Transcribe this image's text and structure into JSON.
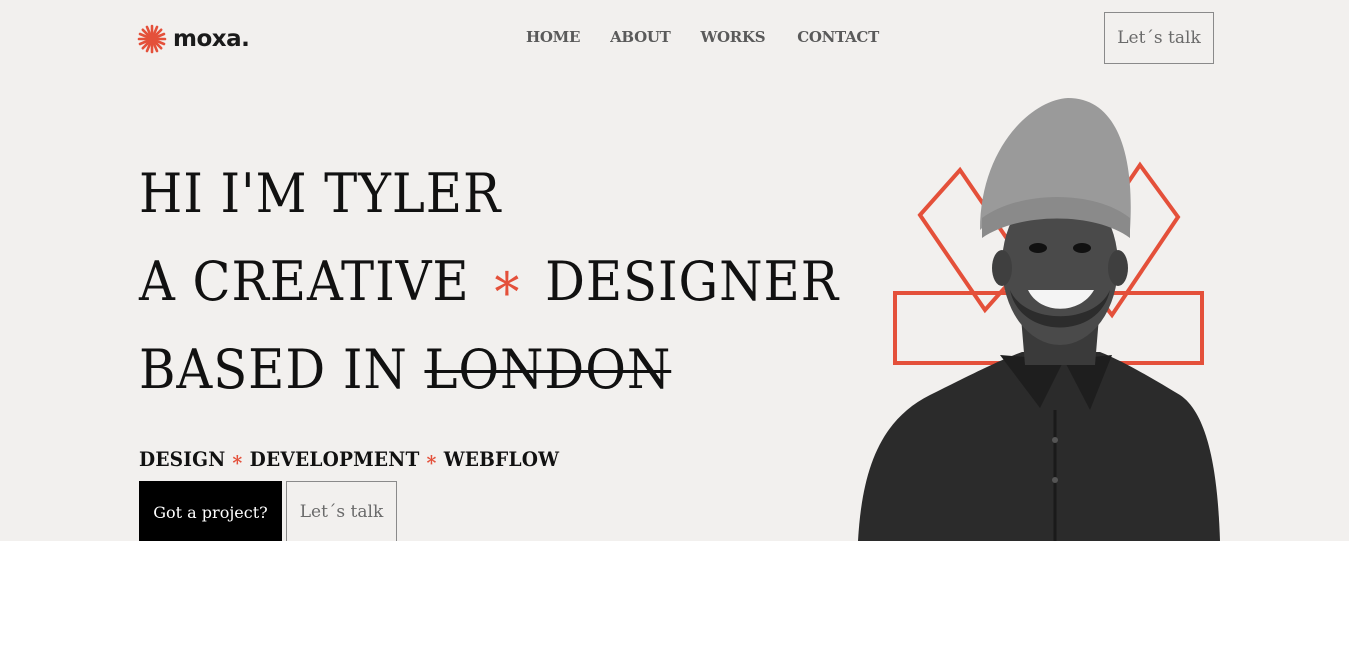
{
  "header": {
    "logo_text": "moxa.",
    "nav": [
      "HOME",
      "ABOUT",
      "WORKS",
      "CONTACT"
    ],
    "cta_label": "Let´s talk"
  },
  "hero": {
    "line1": "HI I'M TYLER",
    "line2_a": "A CREATIVE",
    "line2_star": "∗",
    "line2_b": "DESIGNER",
    "line3_a": "BASED IN",
    "line3_strike": "LONDON",
    "services": [
      "DESIGN",
      "DEVELOPMENT",
      "WEBFLOW"
    ],
    "services_separator": "∗",
    "primary_button": "Got a project?",
    "secondary_button": "Let´s talk"
  },
  "colors": {
    "accent": "#e4503a",
    "hero_background": "#f2f0ee",
    "text": "#111111"
  },
  "icons": {
    "logo": "sunburst-icon",
    "portrait": "person-photo"
  }
}
